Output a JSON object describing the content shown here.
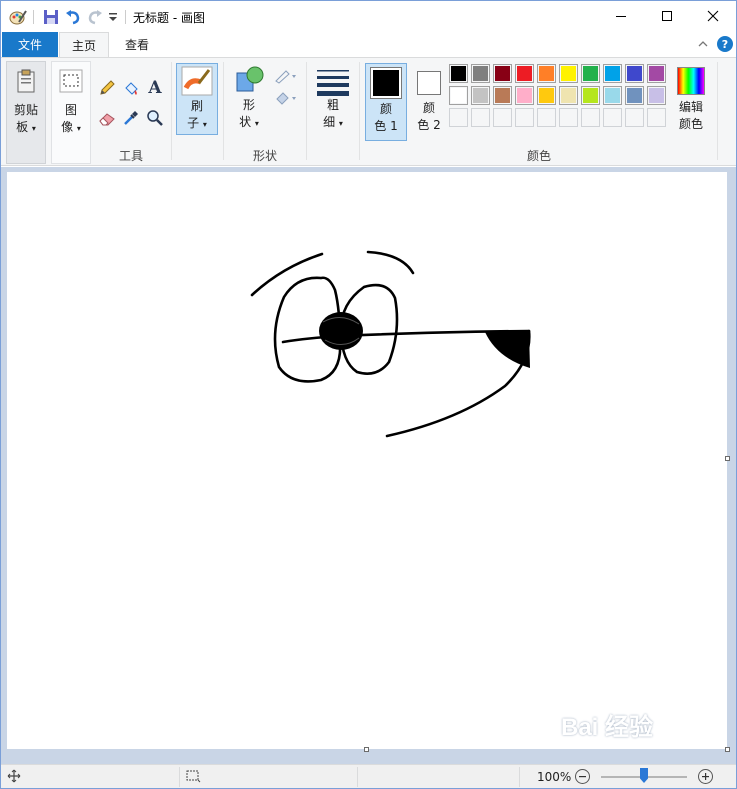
{
  "window": {
    "title": "无标题 - 画图",
    "minimize": "minimize",
    "maximize": "maximize",
    "close": "close"
  },
  "tabs": [
    {
      "label": "文件"
    },
    {
      "label": "主页"
    },
    {
      "label": "查看"
    }
  ],
  "ribbon": {
    "clipboard": {
      "line1": "剪贴",
      "line2": "板"
    },
    "image": {
      "line1": "图",
      "line2": "像"
    },
    "tools_label": "工具",
    "brush": {
      "line1": "刷",
      "line2": "子"
    },
    "shapes": {
      "line1": "形",
      "line2": "状",
      "group_label": "形状"
    },
    "size": {
      "line1": "粗",
      "line2": "细"
    },
    "color1": {
      "line1": "颜",
      "line2": "色 1"
    },
    "color2": {
      "line1": "颜",
      "line2": "色 2"
    },
    "edit_colors": {
      "line1": "编辑",
      "line2": "颜色"
    },
    "colors_label": "颜色",
    "palette_row1": [
      "#000000",
      "#7f7f7f",
      "#880015",
      "#ed1c24",
      "#ff7f27",
      "#fff200",
      "#22b14c",
      "#00a2e8",
      "#3f48cc",
      "#a349a4"
    ],
    "palette_row2": [
      "#ffffff",
      "#c3c3c3",
      "#b97a57",
      "#ffaec9",
      "#ffc90e",
      "#efe4b0",
      "#b5e61d",
      "#99d9ea",
      "#7092be",
      "#c8bfe7"
    ],
    "color1_value": "#000000",
    "color2_value": "#ffffff"
  },
  "status": {
    "zoom": "100%",
    "zoom_level": 0.5
  },
  "watermark": "Bai 经验"
}
